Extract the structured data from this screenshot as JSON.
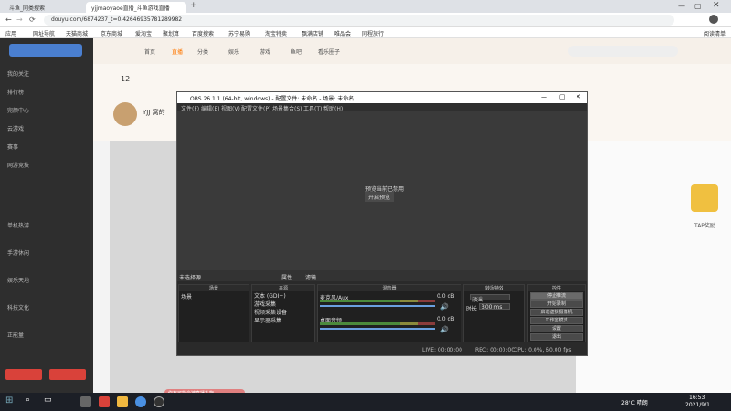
{
  "browser": {
    "tabs": [
      {
        "label": "斗鱼_同类搜索",
        "active": false
      },
      {
        "label": "yjjmaoyaoe直播_斗鱼游戏直播",
        "active": true
      }
    ],
    "url": "douyu.com/6874237_t=0.42646935781289982",
    "bookmarks": [
      "应用",
      "网址导航",
      "天猫商城",
      "京东商城",
      "爱淘宝",
      "聚划算",
      "百度搜索",
      "苏宁易购",
      "淘宝特卖",
      "飘满店铺",
      "唯品会",
      "同程旅行",
      "阅读清单"
    ]
  },
  "douyu": {
    "topnav": [
      "首页",
      "直播",
      "分类",
      "娱乐",
      "游戏",
      "鱼吧",
      "看乐圈子"
    ],
    "leftnav": [
      "我的关注",
      "排行榜",
      "完颜中心",
      "云游戏",
      "赛事",
      "网游竞技",
      "单机热游",
      "手游休闲",
      "娱乐天地",
      "科技文化",
      "正能量"
    ],
    "streamer": {
      "name": "YJJ 窝的",
      "count": "12"
    },
    "notice": "你有可能会被直播礼物",
    "gift_label": "TAP奖励"
  },
  "obs": {
    "title": "OBS 26.1.1 (64-bit, windows) - 配置文件: 未命名 - 场景: 未命名",
    "menu": [
      "文件(F)",
      "编辑(E)",
      "视图(V)",
      "配置文件(P)",
      "场景集合(S)",
      "工具(T)",
      "帮助(H)"
    ],
    "preview_msg": "预览当前已禁用",
    "preview_btn": "开启预览",
    "scenebar": {
      "left": "未选择源",
      "props": "属性",
      "filters": "滤镜"
    },
    "docks": {
      "scenes": {
        "title": "场景",
        "items": [
          "场景"
        ]
      },
      "sources": {
        "title": "来源",
        "items": [
          "文本 (GDI+)",
          "游戏采集",
          "视频采集设备",
          "显示器采集"
        ]
      },
      "mixer": {
        "title": "混音器",
        "tracks": [
          {
            "name": "麦克风/Aux",
            "db": "0.0 dB"
          },
          {
            "name": "桌面音频",
            "db": "0.0 dB"
          }
        ]
      },
      "transitions": {
        "title": "转场特效",
        "type": "淡出",
        "duration_label": "时长",
        "duration": "300 ms"
      },
      "controls": {
        "title": "控件",
        "buttons": [
          "停止推流",
          "开始录制",
          "启动虚拟摄像机",
          "工作室模式",
          "设置",
          "退出"
        ]
      }
    },
    "status": {
      "live": "LIVE: 00:00:00",
      "rec": "REC: 00:00:00",
      "cpu": "CPU: 0.0%, 60.00 fps"
    }
  },
  "taskbar": {
    "weather": "28°C 晴朗",
    "time": "16:53",
    "date": "2021/9/1"
  }
}
